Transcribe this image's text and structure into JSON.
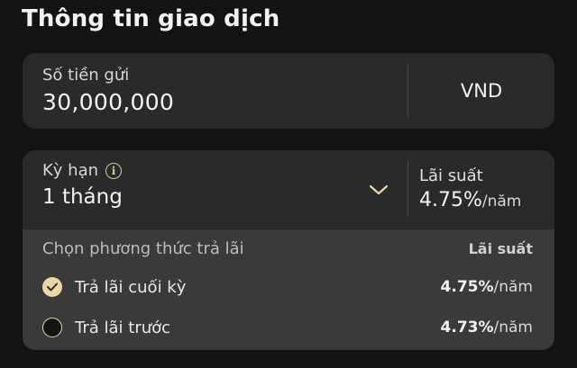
{
  "title": "Thông tin giao dịch",
  "deposit": {
    "label": "Số tiền gửi",
    "amount": "30,000,000",
    "currency": "VND"
  },
  "term": {
    "label": "Kỳ hạn",
    "value": "1 tháng",
    "rate_label": "Lãi suất",
    "rate_value": "4.75%",
    "rate_unit": "/năm"
  },
  "interest_options": {
    "header_left": "Chọn phương thức trả lãi",
    "header_right": "Lãi suất",
    "items": [
      {
        "label": "Trả lãi cuối kỳ",
        "rate": "4.75%",
        "unit": "/năm",
        "selected": true
      },
      {
        "label": "Trả lãi trước",
        "rate": "4.73%",
        "unit": "/năm",
        "selected": false
      }
    ]
  },
  "colors": {
    "accent": "#e8d7a8",
    "background": "#131313",
    "card": "#2a2a2a"
  },
  "icons": [
    "info-icon",
    "chevron-down-icon",
    "check-icon"
  ]
}
